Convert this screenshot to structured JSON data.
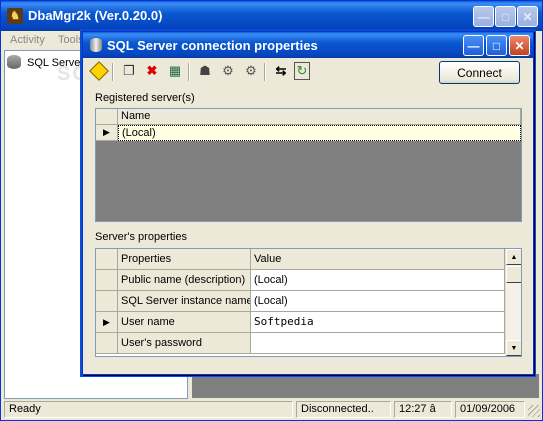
{
  "main_window": {
    "title": "DbaMgr2k (Ver.0.20.0)",
    "menu": [
      "Activity",
      "Tools"
    ],
    "tree_root": "SQL Server",
    "status": {
      "ready": "Ready",
      "connection": "Disconnected..",
      "time": "12:27 â",
      "date": "01/09/2006"
    }
  },
  "watermark": "SOFTPEDIA",
  "dialog": {
    "title": "SQL Server connection properties",
    "connect_label": "Connect",
    "toolbar_icons": [
      "wizard-icon",
      "copy-icon",
      "delete-icon",
      "new-server-icon",
      "server-group-icon",
      "connect-icon",
      "disconnect-icon",
      "swap-icon",
      "refresh-icon"
    ],
    "registered_label": "Registered server(s)",
    "registered_header": "Name",
    "registered_rows": [
      "(Local)"
    ],
    "properties_label": "Server's properties",
    "prop_headers": [
      "Properties",
      "Value"
    ],
    "prop_rows": [
      {
        "name": "Public name (description)",
        "value": "(Local)"
      },
      {
        "name": "SQL Server instance name",
        "value": "(Local)"
      },
      {
        "name": "User name",
        "value": "Softpedia"
      },
      {
        "name": "User's password",
        "value": ""
      }
    ]
  }
}
